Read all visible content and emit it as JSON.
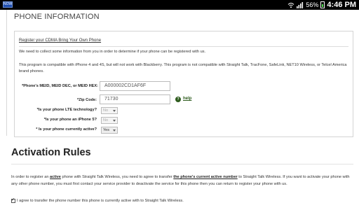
{
  "status": {
    "app_label": "NOW",
    "battery": "56%",
    "time": "4:46 PM",
    "wifi_icon": "wifi-icon",
    "signal_icon": "signal-icon"
  },
  "page_title": "PHONE INFORMATION",
  "panel": {
    "title": "Register your CDMA Bring Your Own Phone",
    "intro": "We need to collect some information from you in order to determine if your phone can be registered with us.",
    "compat": "This program is compatible with iPhone 4 and 4S, but will not work with Blackberry. This program is not compatible with Straight Talk, TracFone, SafeLink, NET10 Wireless, or Telcel America brand phones."
  },
  "form": {
    "meid_label": "*Phone's MEID, MEID DEC, or MEID HEX:",
    "meid_value": "A000002CD1AF6F",
    "zip_label": "*Zip Code:",
    "zip_value": "71730",
    "help_label": "help",
    "lte_label": "*Is your phone LTE technology?",
    "lte_value": "No",
    "iphone5_label": "*Is your phone an iPhone 5?",
    "iphone5_value": "No",
    "active_label": "* Is your phone currently active?",
    "active_value": "Yes"
  },
  "activation": {
    "title": "Activation Rules",
    "p_a": "In order to register an ",
    "p_b": "active",
    "p_c": " phone with Straight Talk Wireless, you need to agree to transfer ",
    "p_d": "the phone's current active number",
    "p_e": " to Straight Talk Wireless. If you want to activate your phone with any other phone number, you must first contact your service provider to deactivate the service for this phone then you can return to register your phone with us.",
    "agree_label": "I agree to transfer the phone number this phone is currently active with to Straight Talk Wireless.",
    "agree_checked": true
  }
}
